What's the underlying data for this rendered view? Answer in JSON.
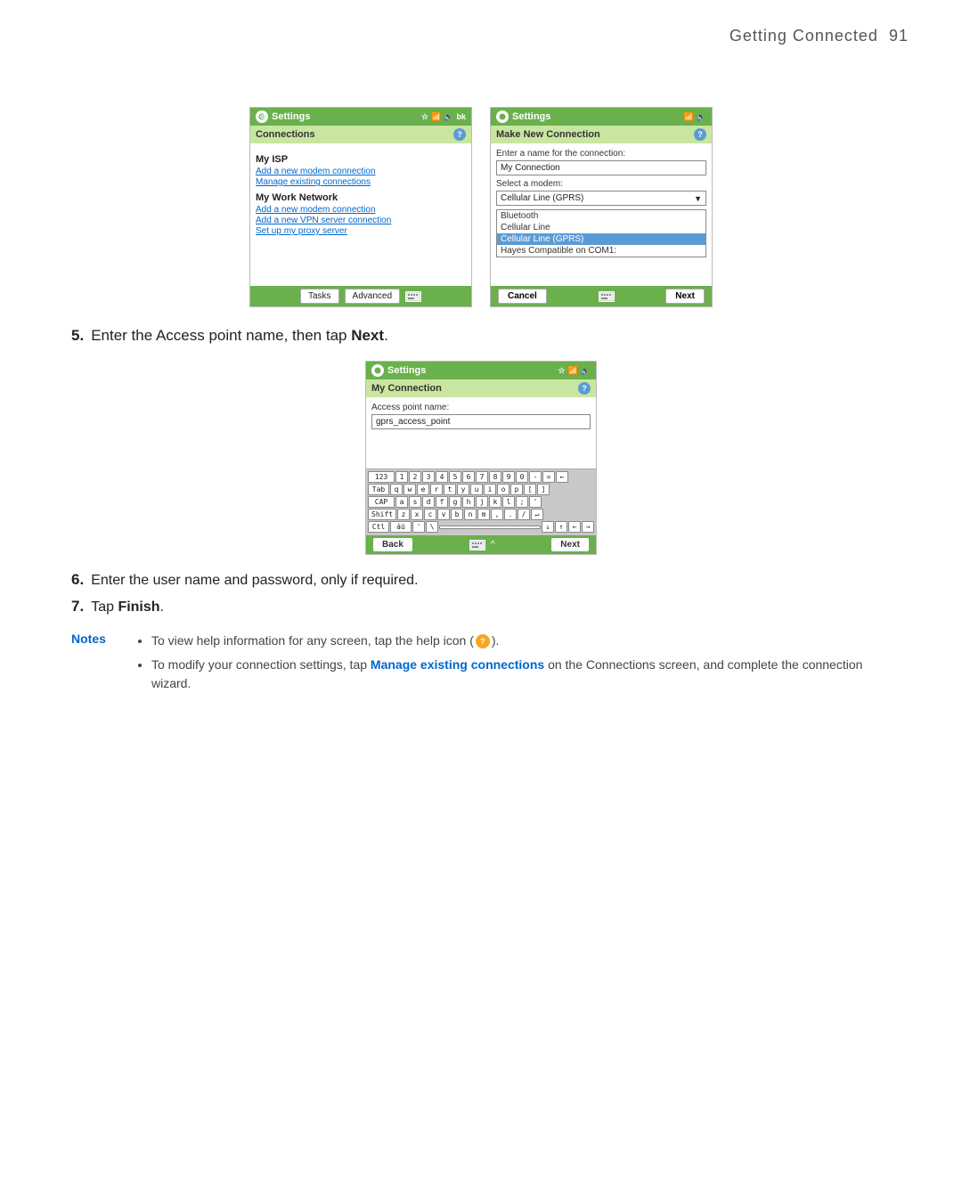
{
  "page": {
    "title": "Getting Connected",
    "page_number": "91"
  },
  "screenshots": {
    "left": {
      "title_bar": "Settings",
      "section_label": "Connections",
      "isp_label": "My ISP",
      "isp_link1": "Add a new modem connection",
      "isp_link2": "Manage existing connections",
      "network_label": "My Work Network",
      "network_link1": "Add a new modem connection",
      "network_link2": "Add a new VPN server connection",
      "network_link3": "Set up my proxy server",
      "footer_tab1": "Tasks",
      "footer_tab2": "Advanced"
    },
    "right": {
      "title_bar": "Settings",
      "section_label": "Make New Connection",
      "name_label": "Enter a name for the connection:",
      "name_value": "My Connection",
      "modem_label": "Select a modem:",
      "modem_value": "Cellular Line (GPRS)",
      "dropdown_items": [
        "Bluetooth",
        "Cellular Line",
        "Cellular Line (GPRS)",
        "Hayes Compatible on COM1:"
      ],
      "selected_item": "Cellular Line (GPRS)",
      "cancel_label": "Cancel",
      "next_label": "Next"
    },
    "third": {
      "title_bar": "Settings",
      "section_label": "My Connection",
      "access_label": "Access point name:",
      "access_value": "gprs_access_point",
      "keyboard_rows": [
        [
          "123",
          "1",
          "2",
          "3",
          "4",
          "5",
          "6",
          "7",
          "8",
          "9",
          "0",
          "-",
          "=",
          "←"
        ],
        [
          "Tab",
          "q",
          "w",
          "e",
          "r",
          "t",
          "y",
          "u",
          "i",
          "o",
          "p",
          "[",
          "]"
        ],
        [
          "CAP",
          "a",
          "s",
          "d",
          "f",
          "g",
          "h",
          "j",
          "k",
          "l",
          ";",
          "'"
        ],
        [
          "Shift",
          "z",
          "x",
          "c",
          "v",
          "b",
          "n",
          "m",
          ",",
          ".",
          "/",
          "↵"
        ],
        [
          "Ctl",
          "áü",
          "'",
          "\\",
          "",
          "",
          "",
          "",
          "",
          "↓",
          "↑",
          "←",
          "→"
        ]
      ],
      "back_label": "Back",
      "next_label": "Next"
    }
  },
  "instructions": {
    "step5": {
      "number": "5.",
      "text": "Enter the Access point name, then tap ",
      "bold_text": "Next"
    },
    "step6": {
      "number": "6.",
      "text": "Enter the user name and password, only if required."
    },
    "step7": {
      "number": "7.",
      "text": "Tap ",
      "bold_text": "Finish"
    }
  },
  "notes": {
    "label": "Notes",
    "items": [
      {
        "text": "To view help information for any screen, tap the help icon (",
        "suffix": ")."
      },
      {
        "text": "To modify your connection settings, tap ",
        "bold": "Manage existing connections",
        "suffix": " on the Connections screen, and complete the connection wizard."
      }
    ]
  }
}
